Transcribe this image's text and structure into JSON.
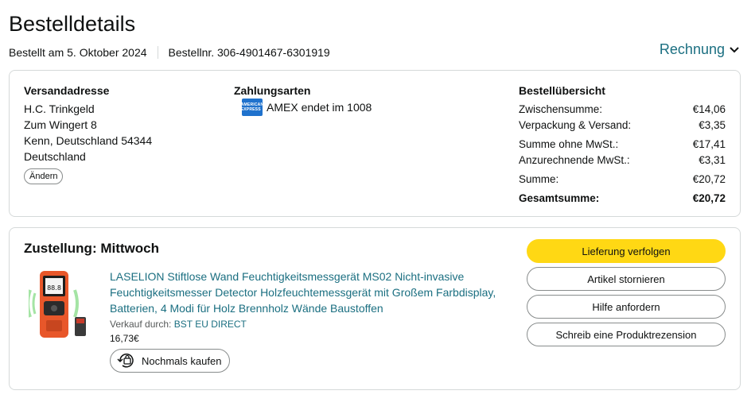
{
  "header": {
    "title": "Bestelldetails",
    "ordered_on": "Bestellt am 5. Oktober 2024",
    "order_number": "Bestellnr. 306-4901467-6301919",
    "invoice_label": "Rechnung"
  },
  "shipping": {
    "title": "Versandadresse",
    "lines": [
      "H.C. Trinkgeld",
      "Zum Wingert 8",
      "Kenn, Deutschland 54344",
      "Deutschland"
    ],
    "change_label": "Ändern"
  },
  "payment": {
    "title": "Zahlungsarten",
    "card_text": "AMEX endet im 1008",
    "card_logo_text": "AMERICAN EXPRESS"
  },
  "summary": {
    "title": "Bestellübersicht",
    "rows": [
      {
        "label": "Zwischensumme:",
        "value": "€14,06"
      },
      {
        "label": "Verpackung & Versand:",
        "value": "€3,35"
      },
      {
        "label": "Summe ohne MwSt.:",
        "value": "€17,41"
      },
      {
        "label": "Anzurechnende MwSt.:",
        "value": "€3,31"
      },
      {
        "label": "Summe:",
        "value": "€20,72"
      },
      {
        "label": "Gesamtsumme:",
        "value": "€20,72"
      }
    ]
  },
  "delivery": {
    "title": "Zustellung: Mittwoch",
    "product_title": "LASELION Stiftlose Wand Feuchtigkeitsmessgerät MS02 Nicht-invasive Feuchtigkeitsmesser Detector Holzfeuchtemessgerät mit Großem Farbdisplay, Batterien, 4 Modi für Holz Brennholz Wände Baustoffen",
    "seller_prefix": "Verkauf durch:",
    "seller_name": "BST EU DIRECT",
    "price": "16,73€",
    "rebuy_label": "Nochmals kaufen",
    "product_display_text": "88.8",
    "actions": [
      "Lieferung verfolgen",
      "Artikel stornieren",
      "Hilfe anfordern",
      "Schreib eine Produktrezension"
    ]
  },
  "colors": {
    "link": "#1b6f81",
    "primary_button": "#ffd814",
    "border": "#d5d9d9"
  }
}
